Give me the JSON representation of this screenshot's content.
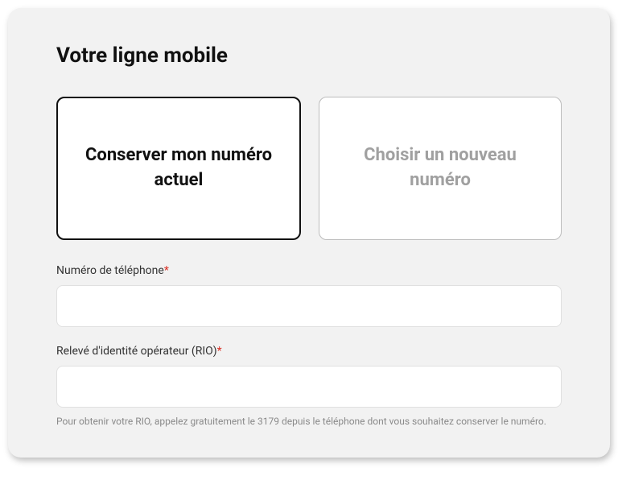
{
  "title": "Votre ligne mobile",
  "options": {
    "keep_number": "Conserver mon numéro actuel",
    "new_number": "Choisir un nouveau numéro"
  },
  "fields": {
    "phone": {
      "label": "Numéro de téléphone",
      "required_marker": "*",
      "value": ""
    },
    "rio": {
      "label": "Relevé d'identité opérateur (RIO)",
      "required_marker": "*",
      "value": "",
      "help": "Pour obtenir votre RIO, appelez gratuitement le 3179 depuis le téléphone dont vous souhaitez conserver le numéro."
    }
  }
}
